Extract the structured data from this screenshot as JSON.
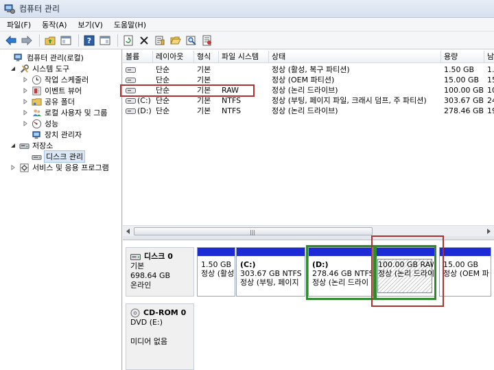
{
  "window": {
    "title": "컴퓨터 관리"
  },
  "menu": [
    "파일(F)",
    "동작(A)",
    "보기(V)",
    "도움말(H)"
  ],
  "tree": {
    "root": "컴퓨터 관리(로컬)",
    "system_tools": "시스템 도구",
    "task_scheduler": "작업 스케줄러",
    "event_viewer": "이벤트 뷰어",
    "shared_folders": "공유 폴더",
    "local_users": "로컬 사용자 및 그룹",
    "performance": "성능",
    "device_manager": "장치 관리자",
    "storage": "저장소",
    "disk_management": "디스크 관리",
    "services": "서비스 및 응용 프로그램"
  },
  "columns": [
    "볼륨",
    "레이아웃",
    "형식",
    "파일 시스템",
    "상태",
    "용량",
    "남"
  ],
  "volumes": [
    {
      "name": "",
      "layout": "단순",
      "type": "기본",
      "fs": "",
      "status": "정상 (활성, 복구 파티션)",
      "capacity": "1.50 GB",
      "free": "1.5"
    },
    {
      "name": "",
      "layout": "단순",
      "type": "기본",
      "fs": "",
      "status": "정상 (OEM 파티션)",
      "capacity": "15.00 GB",
      "free": "15."
    },
    {
      "name": "",
      "layout": "단순",
      "type": "기본",
      "fs": "RAW",
      "status": "정상 (논리 드라이브)",
      "capacity": "100.00 GB",
      "free": "10"
    },
    {
      "name": "(C:)",
      "layout": "단순",
      "type": "기본",
      "fs": "NTFS",
      "status": "정상 (부팅, 페이지 파일, 크래시 덤프, 주 파티션)",
      "capacity": "303.67 GB",
      "free": "24"
    },
    {
      "name": "(D:)",
      "layout": "단순",
      "type": "기본",
      "fs": "NTFS",
      "status": "정상 (논리 드라이브)",
      "capacity": "278.46 GB",
      "free": "19"
    }
  ],
  "disk0": {
    "title": "디스크 0",
    "kind": "기본",
    "size": "698.64 GB",
    "state": "온라인"
  },
  "partitions": [
    {
      "name": "",
      "line1": "1.50 GB",
      "line2": "정상 (활성"
    },
    {
      "name": "(C:)",
      "line1": "303.67 GB NTFS",
      "line2": "정상 (부팅, 페이지"
    },
    {
      "name": "(D:)",
      "line1": "278.46 GB NTFS",
      "line2": "정상 (논리 드라이"
    },
    {
      "name": "",
      "line1": "100.00 GB RAW",
      "line2": "정상 (논리 드라이"
    },
    {
      "name": "",
      "line1": "15.00 GB",
      "line2": "정상 (OEM 파"
    }
  ],
  "cdrom0": {
    "title": "CD-ROM 0",
    "drive": "DVD (E:)",
    "media": "미디어 없음"
  }
}
